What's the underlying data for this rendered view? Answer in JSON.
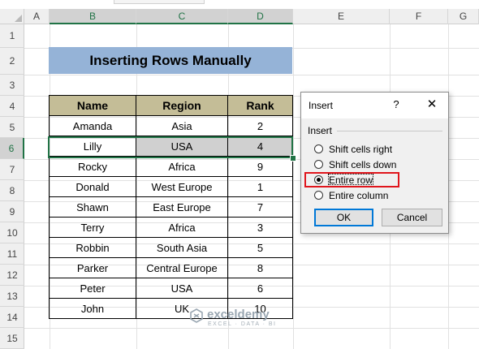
{
  "columns": [
    "A",
    "B",
    "C",
    "D",
    "E",
    "F",
    "G"
  ],
  "rows": [
    "1",
    "2",
    "3",
    "4",
    "5",
    "6",
    "7",
    "8",
    "9",
    "10",
    "11",
    "12",
    "13",
    "14",
    "15"
  ],
  "title": "Inserting Rows Manually",
  "table": {
    "headers": [
      "Name",
      "Region",
      "Rank"
    ],
    "rows": [
      [
        "Amanda",
        "Asia",
        "2"
      ],
      [
        "Lilly",
        "USA",
        "4"
      ],
      [
        "Rocky",
        "Africa",
        "9"
      ],
      [
        "Donald",
        "West Europe",
        "1"
      ],
      [
        "Shawn",
        "East Europe",
        "7"
      ],
      [
        "Terry",
        "Africa",
        "3"
      ],
      [
        "Robbin",
        "South Asia",
        "5"
      ],
      [
        "Parker",
        "Central Europe",
        "8"
      ],
      [
        "Peter",
        "USA",
        "6"
      ],
      [
        "John",
        "UK",
        "10"
      ]
    ],
    "selected_row": "6"
  },
  "dialog": {
    "title": "Insert",
    "help": "?",
    "close": "✕",
    "group": "Insert",
    "options": [
      "Shift cells right",
      "Shift cells down",
      "Entire row",
      "Entire column"
    ],
    "selected_option": "Entire row",
    "ok": "OK",
    "cancel": "Cancel"
  },
  "watermark": {
    "name": "exceldemy",
    "tagline": "EXCEL · DATA · BI"
  },
  "colors": {
    "accent": "#217346",
    "title_fill": "#95b3d7",
    "header_fill": "#c4bd97",
    "highlight": "#e0151c"
  }
}
